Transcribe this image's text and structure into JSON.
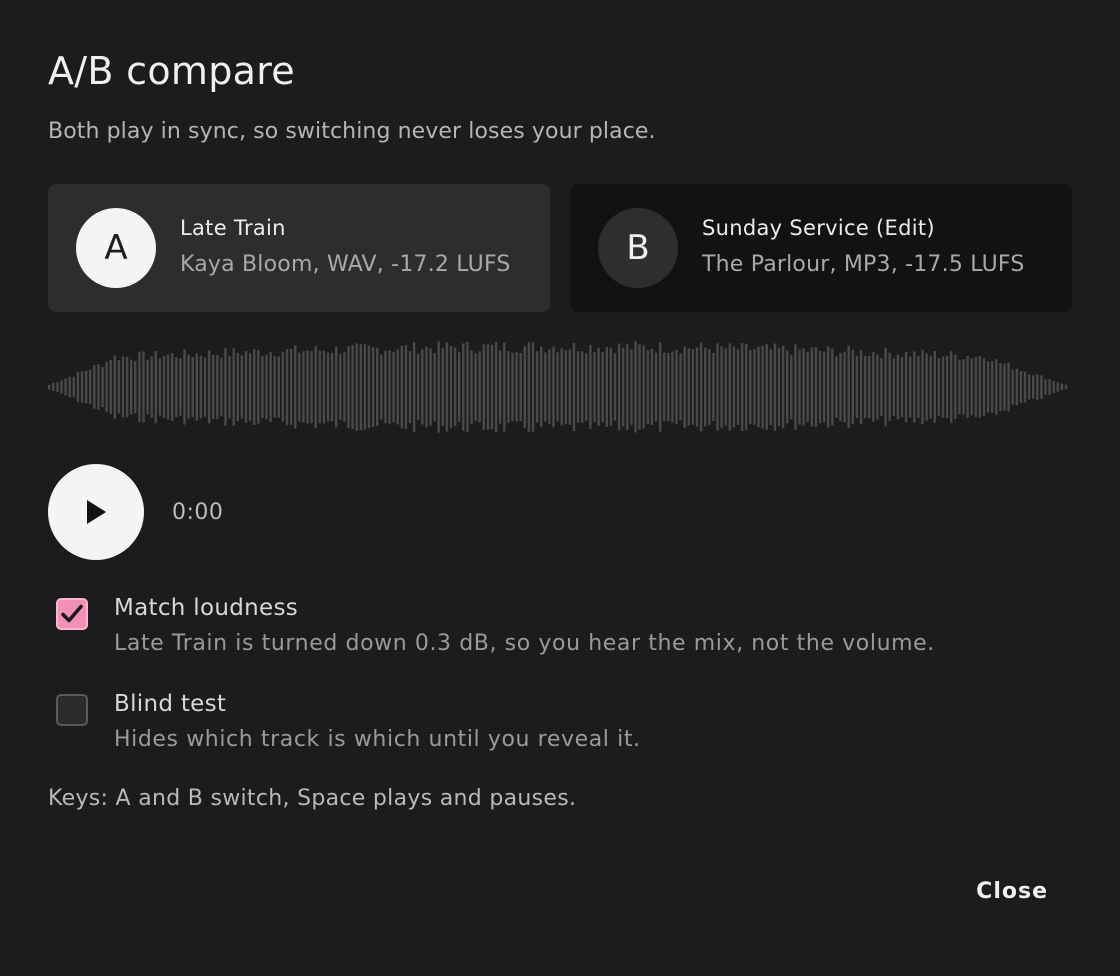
{
  "dialog": {
    "title": "A/B compare",
    "subtitle": "Both play in sync, so switching never loses your place."
  },
  "tracks": [
    {
      "badge": "A",
      "name": "Late Train",
      "meta": "Kaya Bloom, WAV, -17.2 LUFS",
      "selected": true
    },
    {
      "badge": "B",
      "name": "Sunday Service (Edit)",
      "meta": "The Parlour, MP3, -17.5 LUFS",
      "selected": false
    }
  ],
  "player": {
    "time": "0:00",
    "play_icon": "play-icon"
  },
  "options": {
    "match_loudness": {
      "label": "Match loudness",
      "description": "Late Train is turned down 0.3 dB, so you hear the mix, not the volume.",
      "checked": true
    },
    "blind_test": {
      "label": "Blind test",
      "description": "Hides which track is which until you reveal it.",
      "checked": false
    }
  },
  "keys_hint": "Keys: A and B switch, Space plays and pauses.",
  "close_label": "Close",
  "colors": {
    "background": "#1c1c1c",
    "accent": "#f48fb8",
    "waveform": "#4a4a4a"
  }
}
